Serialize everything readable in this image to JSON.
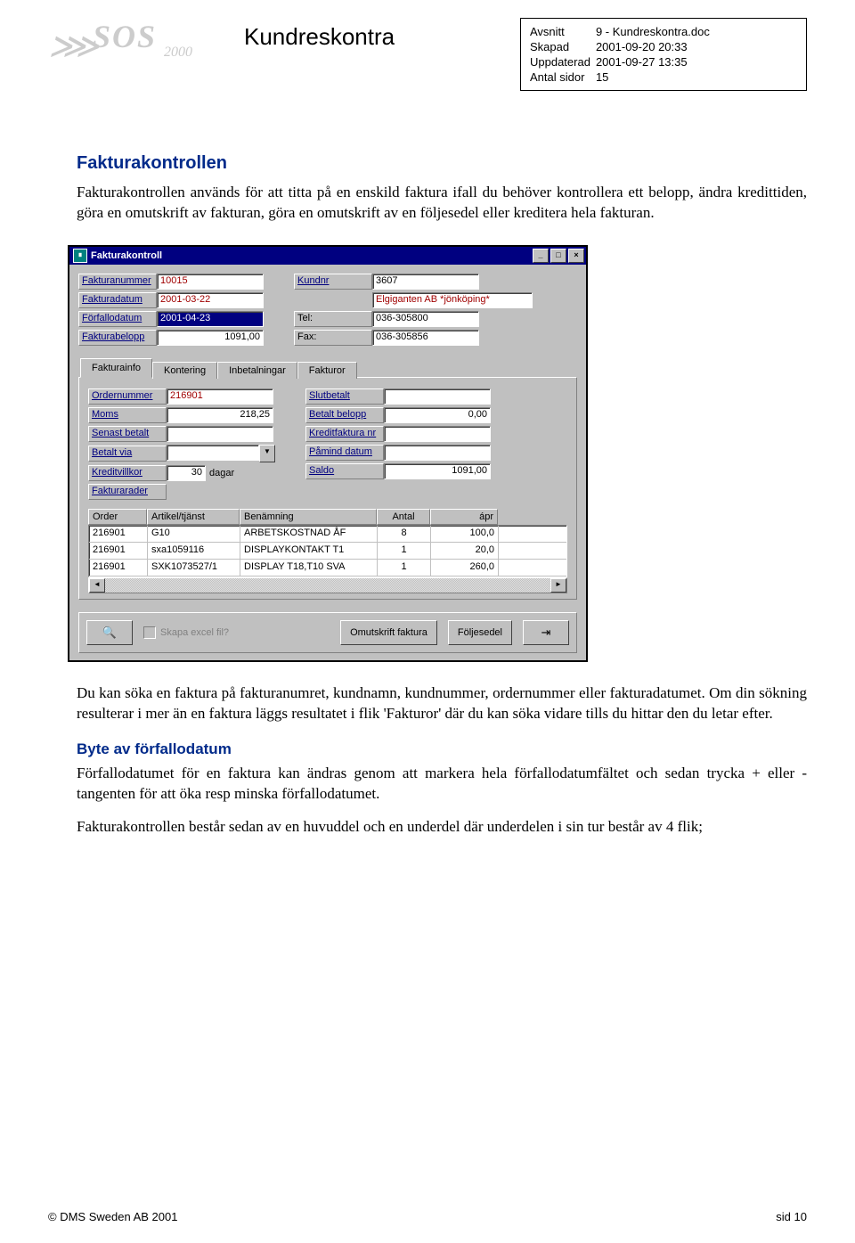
{
  "header": {
    "doctitle": "Kundreskontra",
    "logo": {
      "sos": "SOS",
      "year": "2000"
    }
  },
  "meta": {
    "rows": [
      {
        "k": "Avsnitt",
        "v": "9 - Kundreskontra.doc"
      },
      {
        "k": "Skapad",
        "v": "2001-09-20 20:33"
      },
      {
        "k": "Uppdaterad",
        "v": "2001-09-27 13:35"
      },
      {
        "k": "Antal sidor",
        "v": "15"
      }
    ]
  },
  "s1": {
    "title": "Fakturakontrollen",
    "p": "Fakturakontrollen används för att titta på en enskild faktura ifall du behöver kontrollera ett belopp, ändra kredittiden, göra en omutskrift av fakturan, göra en omutskrift av en följesedel eller kreditera hela fakturan."
  },
  "win": {
    "title": "Fakturakontroll",
    "left": [
      {
        "label": "Fakturanummer",
        "value": "10015",
        "cls": "red"
      },
      {
        "label": "Fakturadatum",
        "value": "2001-03-22",
        "cls": "red"
      },
      {
        "label": "Förfallodatum",
        "value": "2001-04-23",
        "cls": "sel"
      },
      {
        "label": "Fakturabelopp",
        "value": "1091,00",
        "cls": "num"
      }
    ],
    "right": [
      {
        "label": "Kundnr",
        "value": "3607",
        "link": true,
        "cls": ""
      },
      {
        "label": "",
        "value": "Elgiganten AB *jönköping*",
        "cls": "red wide",
        "nolabel": true
      },
      {
        "label": "Tel:",
        "value": "036-305800",
        "plain": true
      },
      {
        "label": "Fax:",
        "value": "036-305856",
        "plain": true
      }
    ],
    "tabs": [
      "Fakturainfo",
      "Kontering",
      "Inbetalningar",
      "Fakturor"
    ],
    "mleft": [
      {
        "label": "Ordernummer",
        "value": "216901",
        "cls": "red"
      },
      {
        "label": "Moms",
        "value": "218,25",
        "cls": "num"
      },
      {
        "label": "Senast betalt",
        "value": ""
      },
      {
        "label": "Betalt via",
        "value": "",
        "combo": true
      },
      {
        "label": "Kreditvillkor",
        "value": "30",
        "kv": true,
        "suffix": "dagar"
      },
      {
        "label": "Fakturarader",
        "value": null,
        "solo": true
      }
    ],
    "mright": [
      {
        "label": "Slutbetalt",
        "value": ""
      },
      {
        "label": "Betalt belopp",
        "value": "0,00",
        "cls": "num"
      },
      {
        "label": "Kreditfaktura nr",
        "value": ""
      },
      {
        "label": "Påmind datum",
        "value": ""
      },
      {
        "label": "Saldo",
        "value": "1091,00",
        "cls": "num"
      }
    ],
    "grid": {
      "headers": [
        "Order",
        "Artikel/tjänst",
        "Benämning",
        "Antal",
        "ápr"
      ],
      "rows": [
        {
          "c": [
            "216901",
            "G10",
            "ARBETSKOSTNAD ÅF",
            "8",
            "100,0"
          ]
        },
        {
          "c": [
            "216901",
            "sxa1059116",
            "DISPLAYKONTAKT T1",
            "1",
            "20,0"
          ]
        },
        {
          "c": [
            "216901",
            "SXK1073527/1",
            "DISPLAY T18,T10 SVA",
            "1",
            "260,0"
          ]
        }
      ]
    },
    "actions": {
      "search_icon": "🔍",
      "excel_label": "Skapa excel fil?",
      "omutskrift": "Omutskrift faktura",
      "foljesedel": "Följesedel",
      "exit_icon": "⇥"
    }
  },
  "p2": "Du kan söka en faktura på fakturanumret, kundnamn, kundnummer, ordernummer eller fakturadatumet. Om din sökning resulterar i mer än en faktura läggs resultatet i flik 'Fakturor' där du kan söka vidare tills du hittar den du letar efter.",
  "s2": {
    "title": "Byte av förfallodatum",
    "p1": "Förfallodatumet för en faktura kan ändras genom att markera hela förfallodatumfältet och sedan trycka + eller - tangenten för att öka resp minska förfallodatumet.",
    "p2": "Fakturakontrollen består sedan av en huvuddel och en underdel där underdelen i sin tur består av 4 flik;"
  },
  "footer": {
    "left": "© DMS Sweden AB 2001",
    "right": "sid 10"
  }
}
